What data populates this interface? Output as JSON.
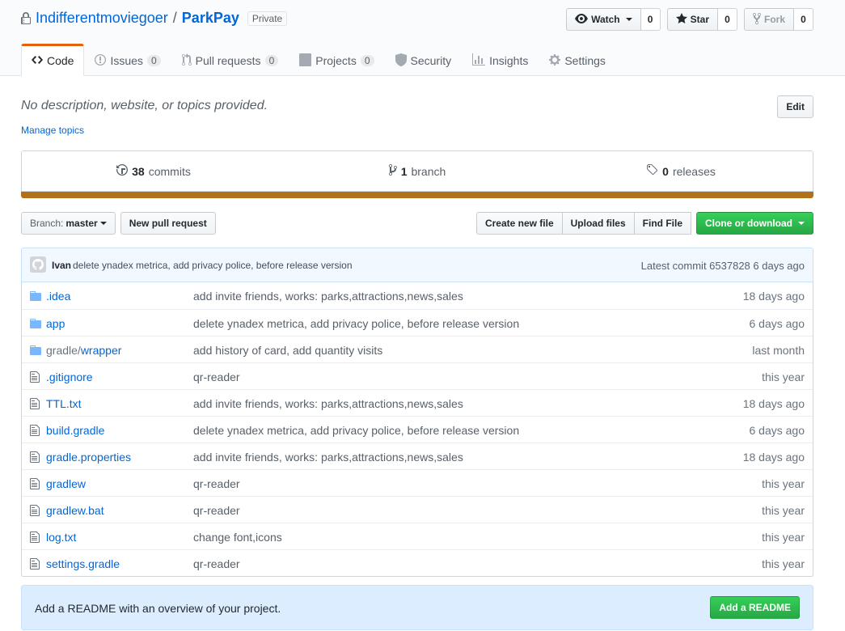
{
  "repo": {
    "owner": "Indifferentmoviegoer",
    "separator": "/",
    "name": "ParkPay",
    "visibility": "Private"
  },
  "actions": {
    "watch_label": "Watch",
    "watch_count": "0",
    "star_label": "Star",
    "star_count": "0",
    "fork_label": "Fork",
    "fork_count": "0"
  },
  "tabs": [
    {
      "label": "Code",
      "count": null,
      "icon": "code-icon"
    },
    {
      "label": "Issues",
      "count": "0",
      "icon": "issue-icon"
    },
    {
      "label": "Pull requests",
      "count": "0",
      "icon": "pull-request-icon"
    },
    {
      "label": "Projects",
      "count": "0",
      "icon": "project-icon"
    },
    {
      "label": "Security",
      "count": null,
      "icon": "shield-icon"
    },
    {
      "label": "Insights",
      "count": null,
      "icon": "graph-icon"
    },
    {
      "label": "Settings",
      "count": null,
      "icon": "gear-icon"
    }
  ],
  "description": {
    "text": "No description, website, or topics provided.",
    "manage_topics": "Manage topics",
    "edit_label": "Edit"
  },
  "summary": {
    "commits_count": "38",
    "commits_label": "commits",
    "branches_count": "1",
    "branches_label": "branch",
    "releases_count": "0",
    "releases_label": "releases"
  },
  "language_color": "#b07219",
  "file_nav": {
    "branch_prefix": "Branch:",
    "branch_name": "master",
    "new_pr": "New pull request",
    "create_file": "Create new file",
    "upload_files": "Upload files",
    "find_file": "Find File",
    "clone": "Clone or download"
  },
  "latest_commit": {
    "author": "Ivan",
    "message": "delete ynadex metrica, add privacy police, before release version",
    "label": "Latest commit 6537828 6 days ago"
  },
  "files": [
    {
      "type": "dir",
      "prefix": "",
      "name": ".idea",
      "message": "add invite friends, works: parks,attractions,news,sales",
      "age": "18 days ago"
    },
    {
      "type": "dir",
      "prefix": "",
      "name": "app",
      "message": "delete ynadex metrica, add privacy police, before release version",
      "age": "6 days ago"
    },
    {
      "type": "dir",
      "prefix": "gradle/",
      "name": "wrapper",
      "message": "add history of card, add quantity visits",
      "age": "last month"
    },
    {
      "type": "file",
      "prefix": "",
      "name": ".gitignore",
      "message": "qr-reader",
      "age": "this year"
    },
    {
      "type": "file",
      "prefix": "",
      "name": "TTL.txt",
      "message": "add invite friends, works: parks,attractions,news,sales",
      "age": "18 days ago"
    },
    {
      "type": "file",
      "prefix": "",
      "name": "build.gradle",
      "message": "delete ynadex metrica, add privacy police, before release version",
      "age": "6 days ago"
    },
    {
      "type": "file",
      "prefix": "",
      "name": "gradle.properties",
      "message": "add invite friends, works: parks,attractions,news,sales",
      "age": "18 days ago"
    },
    {
      "type": "file",
      "prefix": "",
      "name": "gradlew",
      "message": "qr-reader",
      "age": "this year"
    },
    {
      "type": "file",
      "prefix": "",
      "name": "gradlew.bat",
      "message": "qr-reader",
      "age": "this year"
    },
    {
      "type": "file",
      "prefix": "",
      "name": "log.txt",
      "message": "change font,icons",
      "age": "this year"
    },
    {
      "type": "file",
      "prefix": "",
      "name": "settings.gradle",
      "message": "qr-reader",
      "age": "this year"
    }
  ],
  "readme": {
    "text": "Add a README with an overview of your project.",
    "button": "Add a README"
  }
}
